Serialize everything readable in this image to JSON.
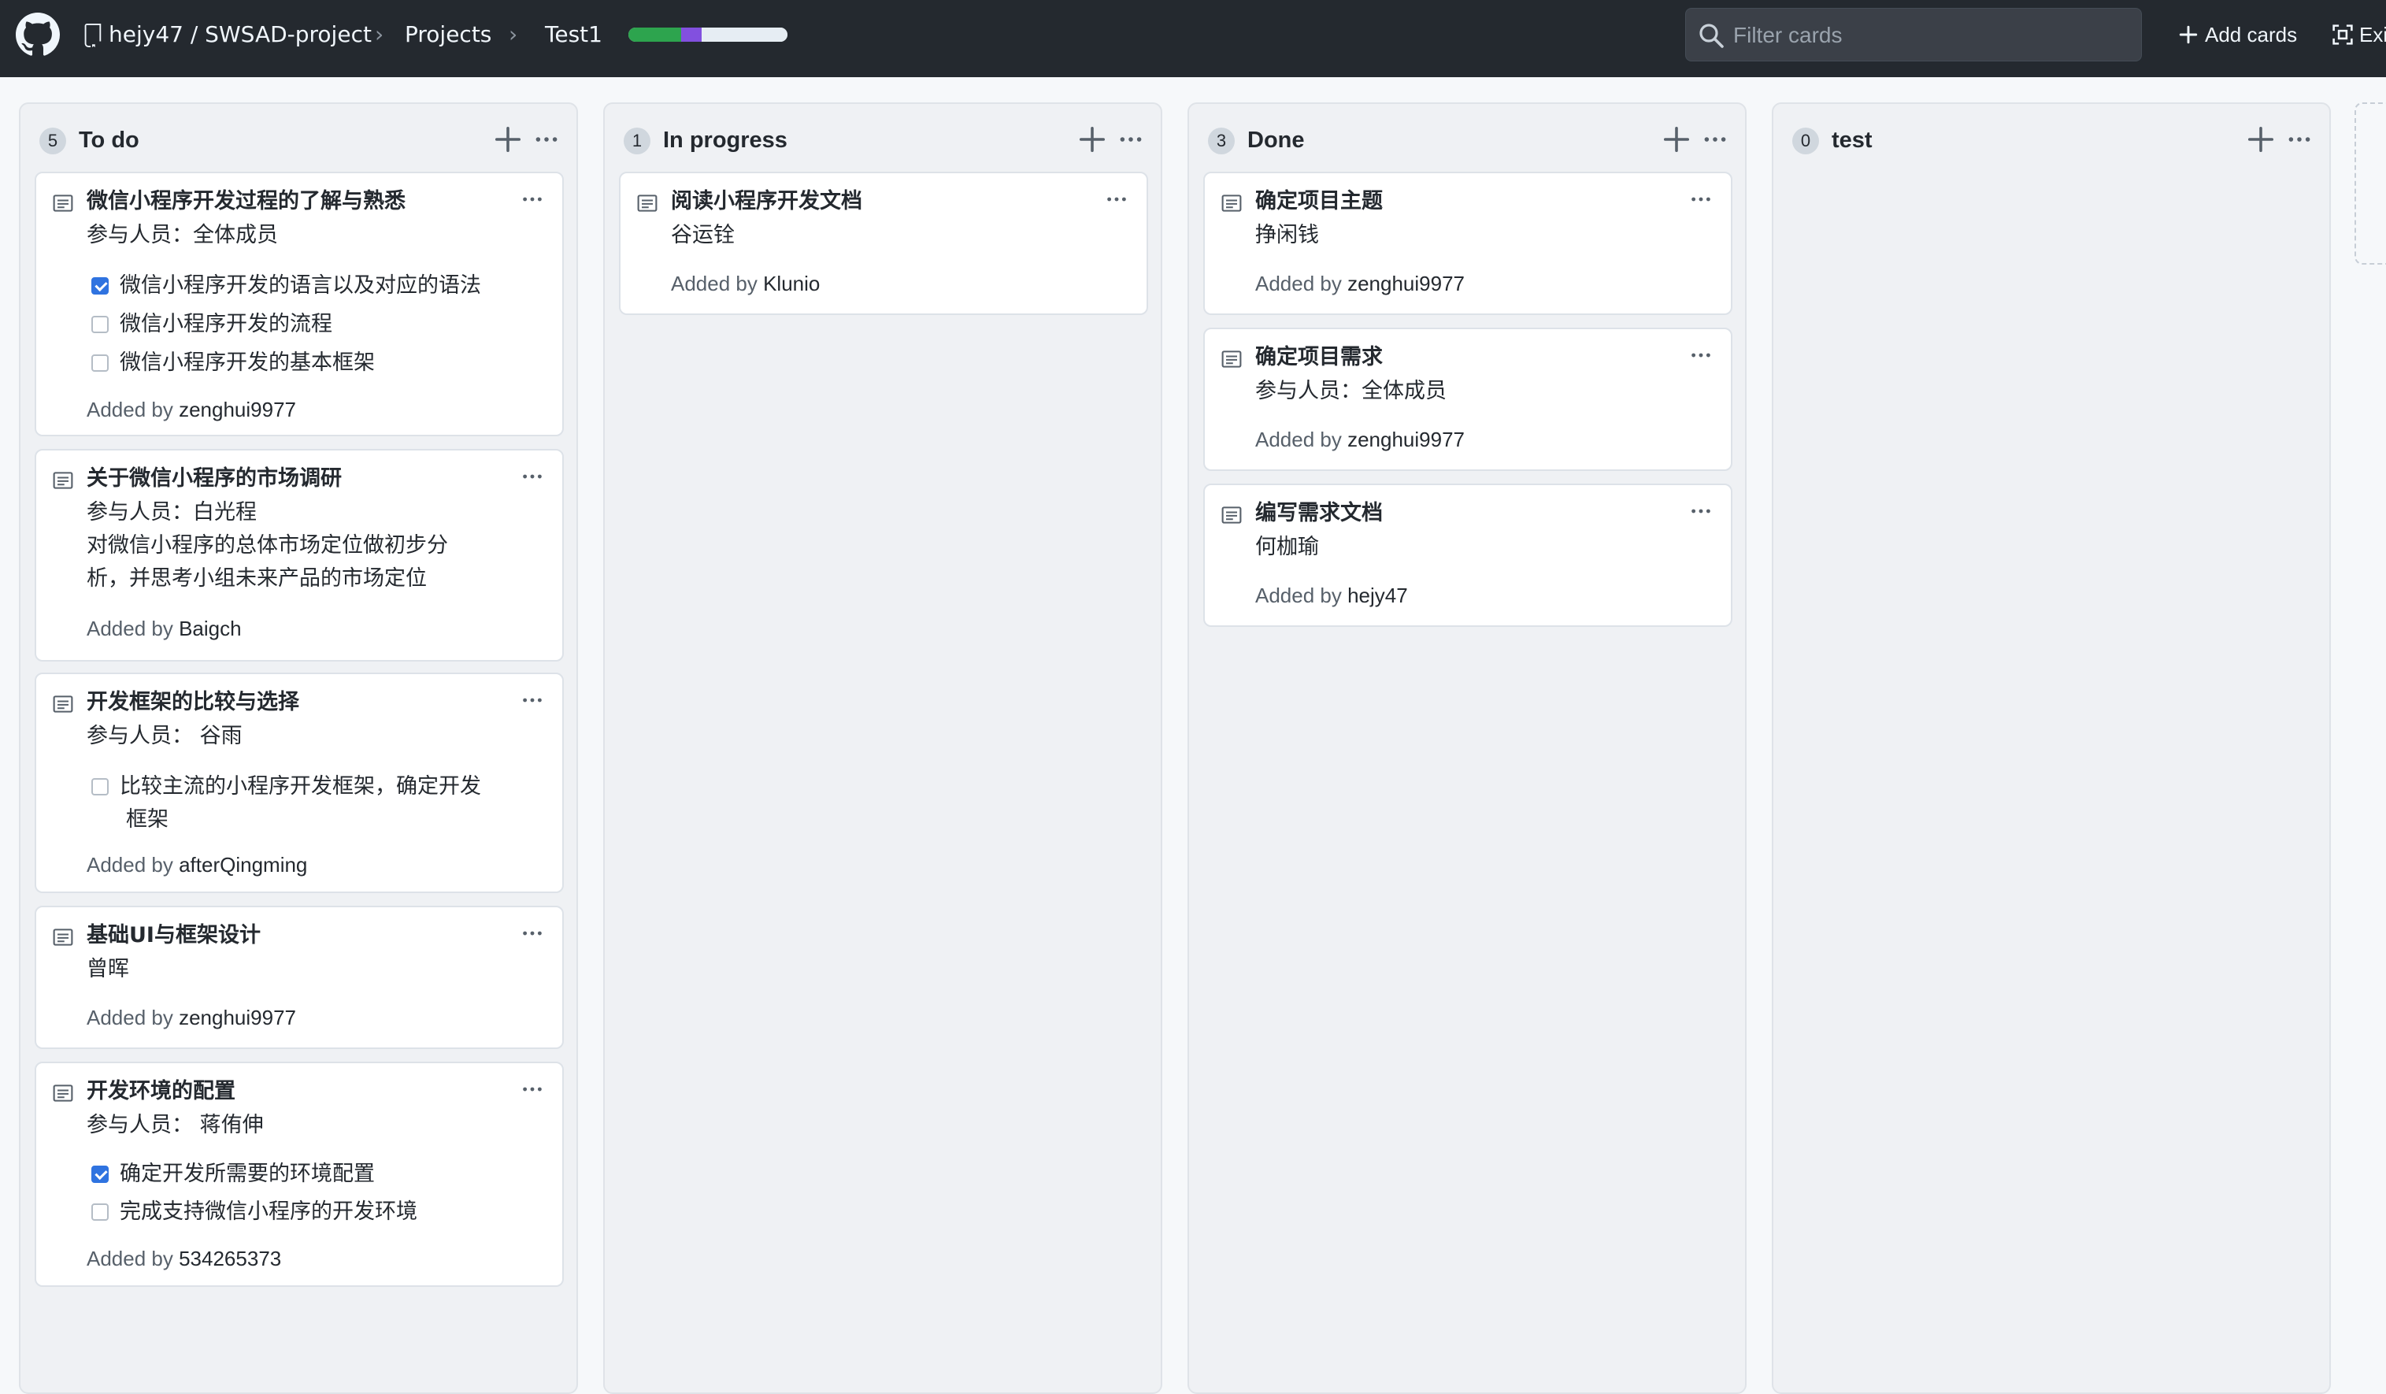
{
  "header": {
    "repo": "hejy47 / SWSAD-project",
    "projects_link": "Projects",
    "project_name": "Test1",
    "progress": [
      {
        "label": "done",
        "fraction": 0.33,
        "color": "#2da44e"
      },
      {
        "label": "in-progress",
        "fraction": 0.13,
        "color": "#8250df"
      },
      {
        "label": "todo",
        "fraction": 0.54,
        "color": "#e6edf3"
      }
    ],
    "search_placeholder": "Filter cards",
    "add_cards_label": "Add cards",
    "exit_label": "Exi"
  },
  "columns": [
    {
      "title": "To do",
      "count": "5",
      "cards": [
        {
          "title": "微信小程序开发过程的了解与熟悉",
          "lines": [
            "参与人员：全体成员"
          ],
          "checks": [
            {
              "label": "微信小程序开发的语言以及对应的语法",
              "checked": true
            },
            {
              "label": "微信小程序开发的流程",
              "checked": false
            },
            {
              "label": "微信小程序开发的基本框架",
              "checked": false
            }
          ],
          "added_by": "zenghui9977"
        },
        {
          "title": "关于微信小程序的市场调研",
          "lines": [
            "参与人员：白光程",
            "对微信小程序的总体市场定位做初步分",
            "析，并思考小组未来产品的市场定位"
          ],
          "checks": [],
          "added_by": "Baigch"
        },
        {
          "title": "开发框架的比较与选择",
          "lines": [
            "参与人员：  谷雨"
          ],
          "checks": [
            {
              "label": "比较主流的小程序开发框架，确定开发",
              "label2": "框架",
              "checked": false
            }
          ],
          "added_by": "afterQingming"
        },
        {
          "title": "基础UI与框架设计",
          "lines": [
            "曾晖"
          ],
          "checks": [],
          "added_by": "zenghui9977"
        },
        {
          "title": "开发环境的配置",
          "lines": [
            "参与人员：  蒋侑伸"
          ],
          "checks": [
            {
              "label": "确定开发所需要的环境配置",
              "checked": true
            },
            {
              "label": "完成支持微信小程序的开发环境",
              "checked": false
            }
          ],
          "added_by": "534265373"
        }
      ]
    },
    {
      "title": "In progress",
      "count": "1",
      "cards": [
        {
          "title": "阅读小程序开发文档",
          "lines": [
            "谷运铨"
          ],
          "checks": [],
          "added_by": "Klunio"
        }
      ]
    },
    {
      "title": "Done",
      "count": "3",
      "cards": [
        {
          "title": "确定项目主题",
          "lines": [
            "挣闲钱"
          ],
          "checks": [],
          "added_by": "zenghui9977"
        },
        {
          "title": "确定项目需求",
          "lines": [
            "参与人员：全体成员"
          ],
          "checks": [],
          "added_by": "zenghui9977"
        },
        {
          "title": "编写需求文档",
          "lines": [
            "何枷瑜"
          ],
          "checks": [],
          "added_by": "hejy47"
        }
      ]
    },
    {
      "title": "test",
      "count": "0",
      "cards": []
    }
  ],
  "added_by_prefix": "Added by "
}
